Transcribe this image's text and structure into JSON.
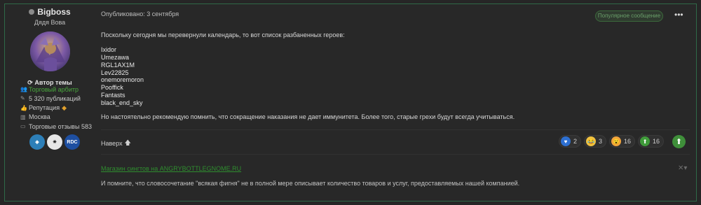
{
  "author": {
    "name": "Bigboss",
    "title": "Дядя Вова",
    "topic_author_label": "Автор темы",
    "stats": [
      {
        "icon": "users-icon",
        "label": "Торговый арбитр",
        "value": ""
      },
      {
        "icon": "edit-icon",
        "label": "5 320 публикаций",
        "value": ""
      },
      {
        "icon": "thumbs-up-icon",
        "label": "Репутация",
        "value": ""
      },
      {
        "icon": "building-icon",
        "label": "Москва",
        "value": ""
      },
      {
        "icon": "id-card-icon",
        "label": "Торговые отзывы",
        "value": "583"
      }
    ],
    "badges": [
      "RDC"
    ]
  },
  "post": {
    "published": "Опубликовано: 3 сентября",
    "popular_badge": "Популярное сообщение",
    "intro": "Поскольку сегодня мы перевернули календарь, то вот список разбаненных героев:",
    "heroes": [
      "Ixidor",
      "Umezawa",
      "RGL1AX1M",
      "Lev22825",
      "onemoremoron",
      "Pooffick",
      "Fantasts",
      "black_end_sky"
    ],
    "note": "Но настоятельно рекомендую помнить, что сокращение наказания не дает иммунитета. Более того, старые грехи будут всегда учитываться.",
    "top_link": "Наверх"
  },
  "reactions": [
    {
      "name": "heart",
      "count": "2"
    },
    {
      "name": "laugh",
      "count": "3"
    },
    {
      "name": "wow",
      "count": "16"
    },
    {
      "name": "upvote",
      "count": "16"
    }
  ],
  "signature": {
    "link": "Магазин сингтов на ANGRYBOTTLEGNOME.RU",
    "text": "И помните, что словосочетание \"всякая фигня\" не в полной мере описывает количество товаров и услуг, предоставляемых нашей компанией."
  }
}
